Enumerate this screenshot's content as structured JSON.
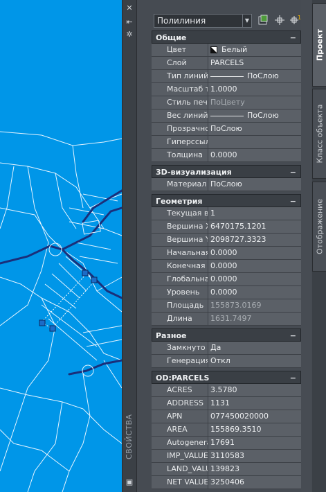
{
  "palette": {
    "title": "СВОЙСТВА",
    "object_type": "Полилиния"
  },
  "sections": [
    {
      "title": "Общие",
      "rows": [
        {
          "k": "Цвет",
          "v": "Белый",
          "kind": "color"
        },
        {
          "k": "Слой",
          "v": "PARCELS"
        },
        {
          "k": "Тип линий",
          "v": "ПоСлою",
          "kind": "line"
        },
        {
          "k": "Масштаб ти...",
          "v": "1.0000"
        },
        {
          "k": "Стиль печати",
          "v": "ПоЦвету",
          "ro": true
        },
        {
          "k": "Вес линий",
          "v": "ПоСлою",
          "kind": "line"
        },
        {
          "k": "Прозрачнос...",
          "v": "ПоСлою"
        },
        {
          "k": "Гиперссылка",
          "v": ""
        },
        {
          "k": "Толщина",
          "v": "0.0000"
        }
      ]
    },
    {
      "title": "3D-визуализация",
      "rows": [
        {
          "k": "Материал",
          "v": "ПоСлою"
        }
      ]
    },
    {
      "title": "Геометрия",
      "rows": [
        {
          "k": "Текущая ве...",
          "v": "1"
        },
        {
          "k": "Вершина X",
          "v": "6470175.1201"
        },
        {
          "k": "Вершина Y",
          "v": "2098727.3323"
        },
        {
          "k": "Начальная ...",
          "v": "0.0000"
        },
        {
          "k": "Конечная ш...",
          "v": "0.0000"
        },
        {
          "k": "Глобальная...",
          "v": "0.0000"
        },
        {
          "k": "Уровень",
          "v": "0.0000"
        },
        {
          "k": "Площадь",
          "v": "155873.0169",
          "ro": true
        },
        {
          "k": "Длина",
          "v": "1631.7497",
          "ro": true
        }
      ]
    },
    {
      "title": "Разное",
      "rows": [
        {
          "k": "Замкнуто",
          "v": "Да"
        },
        {
          "k": "Генерация т...",
          "v": "Откл"
        }
      ]
    },
    {
      "title": "OD:PARCELS",
      "rows": [
        {
          "k": "ACRES",
          "v": "3.5780"
        },
        {
          "k": "ADDRESS",
          "v": "1131"
        },
        {
          "k": "APN",
          "v": "077450020000"
        },
        {
          "k": "AREA",
          "v": "155869.3510"
        },
        {
          "k": "Autogenerat...",
          "v": "17691"
        },
        {
          "k": "IMP_VALUE",
          "v": "3110583"
        },
        {
          "k": "LAND_VALUE",
          "v": "139823"
        },
        {
          "k": "NET VALUE",
          "v": "3250406"
        }
      ]
    }
  ],
  "tabs": [
    {
      "label": "Проект",
      "active": true
    },
    {
      "label": "Класс объекта",
      "active": false
    },
    {
      "label": "Отображение",
      "active": false
    }
  ],
  "colors": {
    "map_background": "#0096e8",
    "panel": "#464b52"
  },
  "icons": [
    "close-icon",
    "pin-icon",
    "settings-icon",
    "quick-select-icon",
    "select-objects-icon",
    "toggle-pickadd-icon"
  ]
}
